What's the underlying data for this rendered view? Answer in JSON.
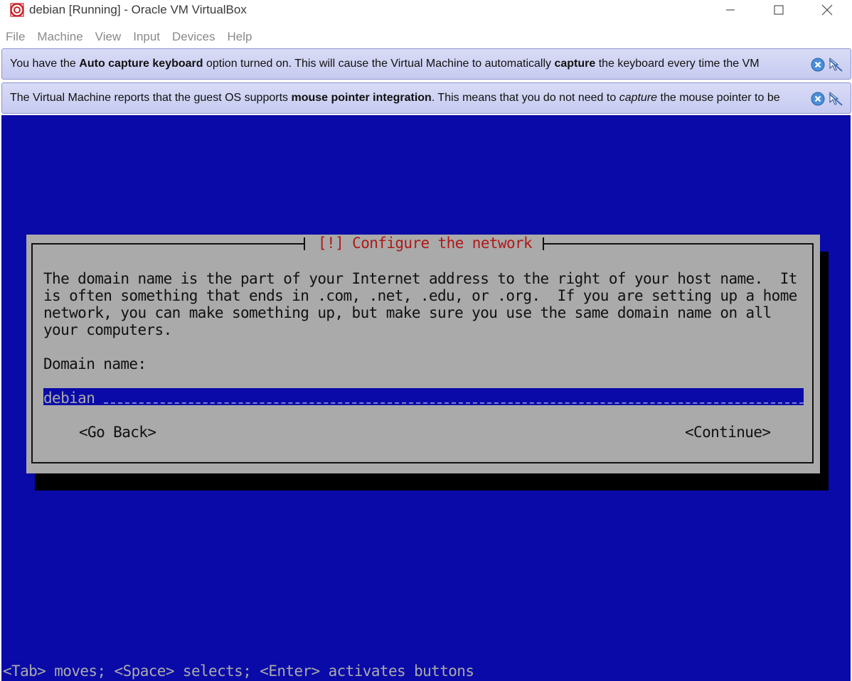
{
  "window": {
    "title": "debian [Running] - Oracle VM VirtualBox"
  },
  "menu": {
    "items": [
      "File",
      "Machine",
      "View",
      "Input",
      "Devices",
      "Help"
    ]
  },
  "notices": [
    {
      "parts": [
        {
          "text": "You have the ",
          "style": "normal"
        },
        {
          "text": "Auto capture keyboard",
          "style": "bold"
        },
        {
          "text": " option turned on. This will cause the Virtual Machine to automatically ",
          "style": "normal"
        },
        {
          "text": "capture",
          "style": "bold"
        },
        {
          "text": " the keyboard every time the VM",
          "style": "normal"
        }
      ]
    },
    {
      "parts": [
        {
          "text": "The Virtual Machine reports that the guest OS supports ",
          "style": "normal"
        },
        {
          "text": "mouse pointer integration",
          "style": "bold"
        },
        {
          "text": ". This means that you do not need to ",
          "style": "normal"
        },
        {
          "text": "capture",
          "style": "italic"
        },
        {
          "text": " the mouse pointer to be",
          "style": "normal"
        }
      ]
    }
  ],
  "installer": {
    "dialog_title": "[!] Configure the network",
    "body_lines": [
      "The domain name is the part of your Internet address to the right of your host name.  It",
      "is often something that ends in .com, .net, .edu, or .org.  If you are setting up a home",
      "network, you can make something up, but make sure you use the same domain name on all",
      "your computers."
    ],
    "field_label": "Domain name:",
    "domain_value": "debian",
    "go_back_label": "<Go Back>",
    "continue_label": "<Continue>",
    "help_text": "<Tab> moves; <Space> selects; <Enter> activates buttons"
  },
  "colors": {
    "vm_background": "#0a0aa8",
    "dialog_background": "#aaaaaa",
    "dialog_title": "#b01818",
    "notice_background": "#cdd0f3"
  },
  "icons": {
    "app": "virtualbox-logo-icon",
    "notice_close": "close-circle-icon",
    "notice_mute": "mute-message-icon"
  }
}
